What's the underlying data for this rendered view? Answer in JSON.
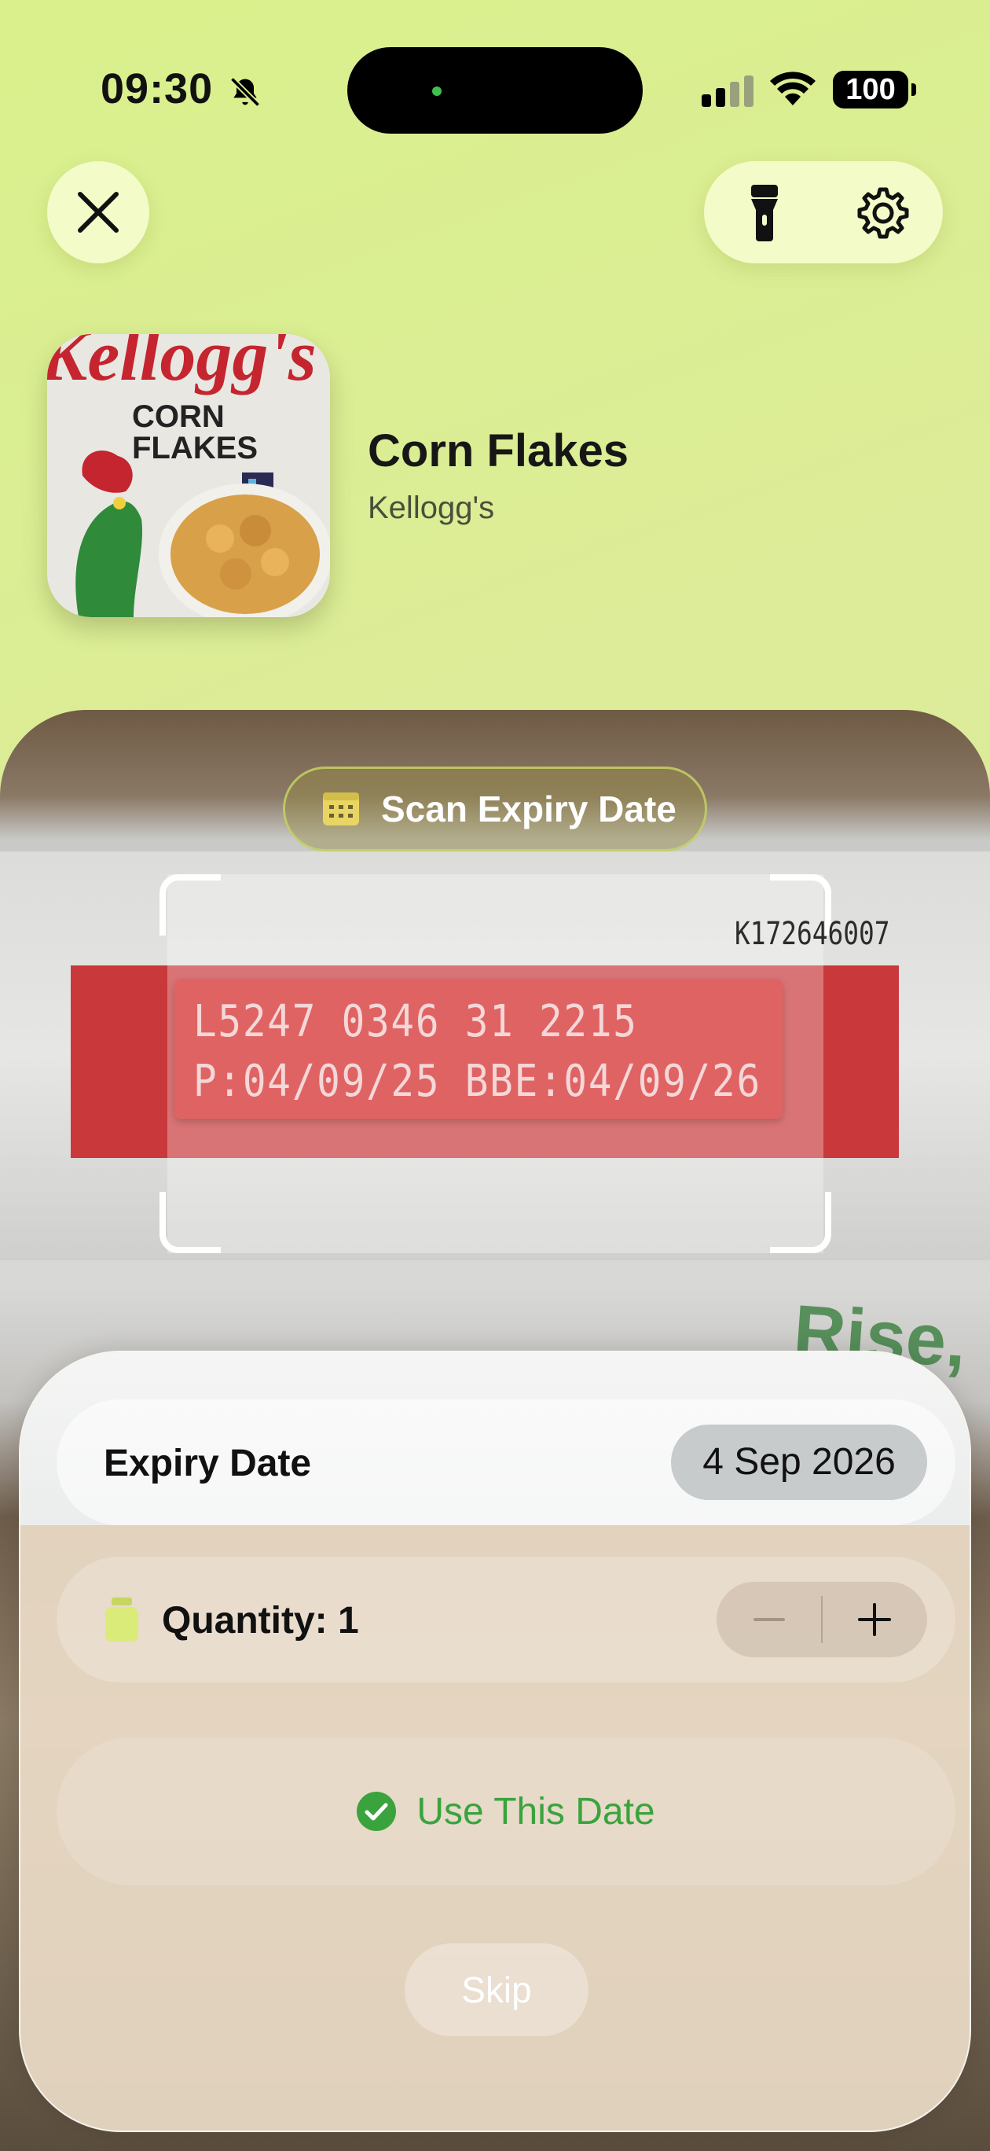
{
  "status_bar": {
    "time": "09:30",
    "battery": "100"
  },
  "product": {
    "title": "Corn Flakes",
    "brand": "Kellogg's",
    "box_brand": "Kellogg's",
    "box_name_line1": "CORN",
    "box_name_line2": "FLAKES"
  },
  "camera": {
    "scan_chip_label": "Scan Expiry Date",
    "box_code": "K172646007",
    "lot_line1": "L5247 0346 31 2215",
    "lot_line2": "P:04/09/25 BBE:04/09/26",
    "background_text": "Rise,"
  },
  "sheet": {
    "expiry_label": "Expiry Date",
    "expiry_value": "4 Sep 2026",
    "quantity_label": "Quantity: 1",
    "use_button": "Use This Date",
    "skip_button": "Skip"
  },
  "colors": {
    "accent_green": "#3aa33e",
    "background": "#dcec98",
    "jar_icon": "#dbeb7a"
  }
}
